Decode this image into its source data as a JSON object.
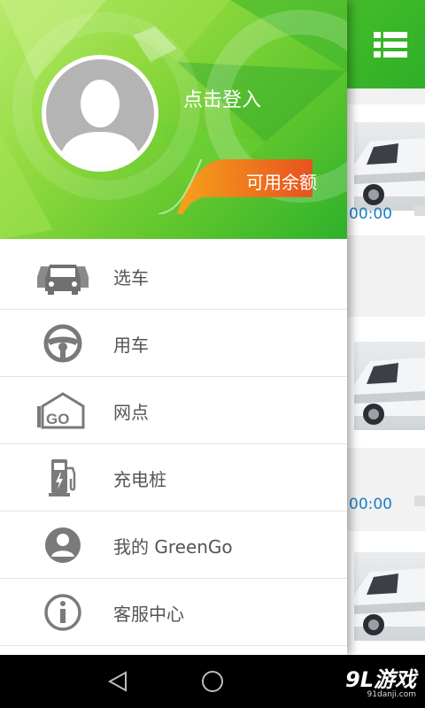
{
  "drawer": {
    "login_label": "点击登入",
    "balance_label": "可用余额",
    "menu": [
      {
        "label": "选车",
        "icon": "cars-icon"
      },
      {
        "label": "用车",
        "icon": "steering-wheel-icon"
      },
      {
        "label": "网点",
        "icon": "go-station-icon"
      },
      {
        "label": "充电桩",
        "icon": "charging-pile-icon"
      },
      {
        "label": "我的 GreenGo",
        "icon": "user-icon"
      },
      {
        "label": "客服中心",
        "icon": "info-icon"
      }
    ]
  },
  "main": {
    "menu_icon": "list-menu-icon",
    "cards": [
      {
        "time": "00:00"
      },
      {
        "time": "00:00"
      },
      {
        "time": ""
      }
    ]
  },
  "navbar": {
    "back": "back-icon",
    "home": "home-icon"
  },
  "watermark": {
    "brand": "9L游戏",
    "url": "91danji.com"
  },
  "colors": {
    "green": "#5cc52c",
    "orange": "#ee6a1f",
    "link_blue": "#1a7ec7"
  }
}
